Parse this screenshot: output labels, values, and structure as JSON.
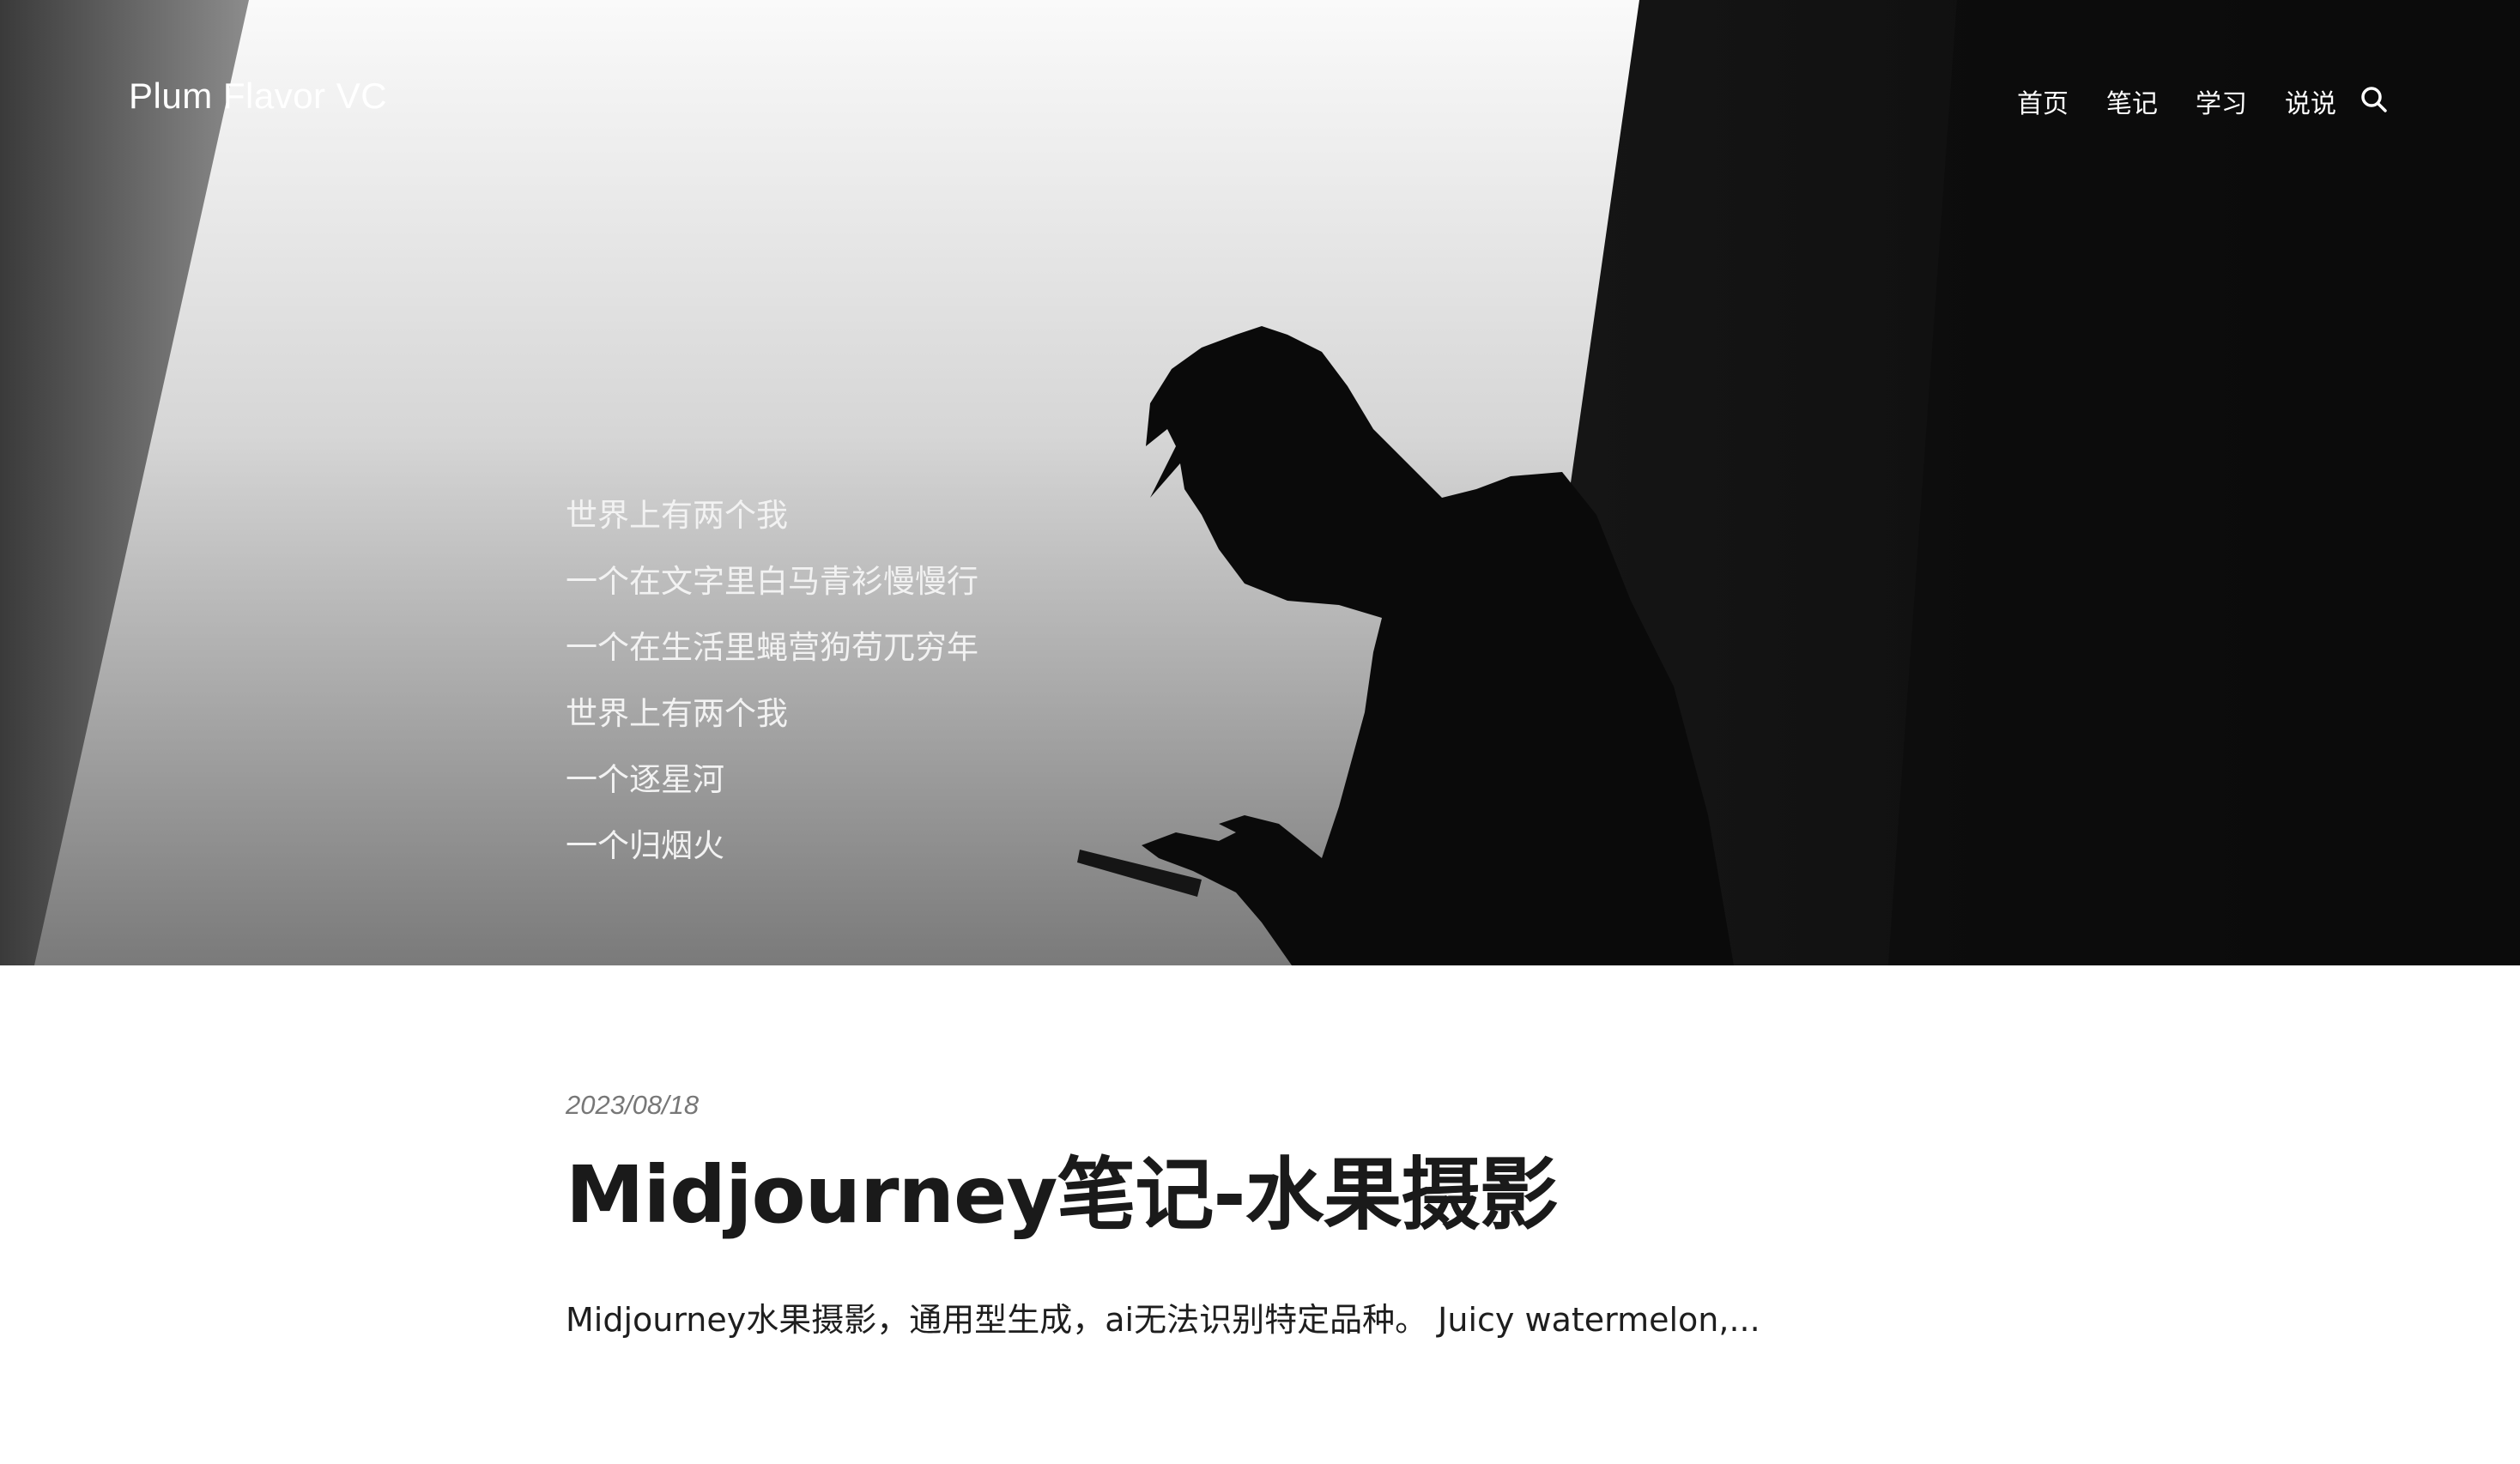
{
  "header": {
    "site_title": "Plum Flavor VC",
    "nav": [
      {
        "label": "首页"
      },
      {
        "label": "笔记"
      },
      {
        "label": "学习"
      },
      {
        "label": "说说"
      }
    ],
    "search_icon": "search-icon"
  },
  "hero": {
    "poem_lines": [
      "世界上有两个我",
      "一个在文字里白马青衫慢慢行",
      "一个在生活里蝇营狗苟兀穷年",
      "世界上有两个我",
      "一个逐星河",
      "一个归烟火"
    ]
  },
  "post": {
    "date": "2023/08/18",
    "title": "Midjourney笔记-水果摄影",
    "excerpt": "Midjourney水果摄影，通用型生成，ai无法识别特定品种。 Juicy watermelon,..."
  },
  "colors": {
    "hero_dark": "#0c0c0c",
    "title_text": "#1a1a1a",
    "date_text": "#777777"
  }
}
